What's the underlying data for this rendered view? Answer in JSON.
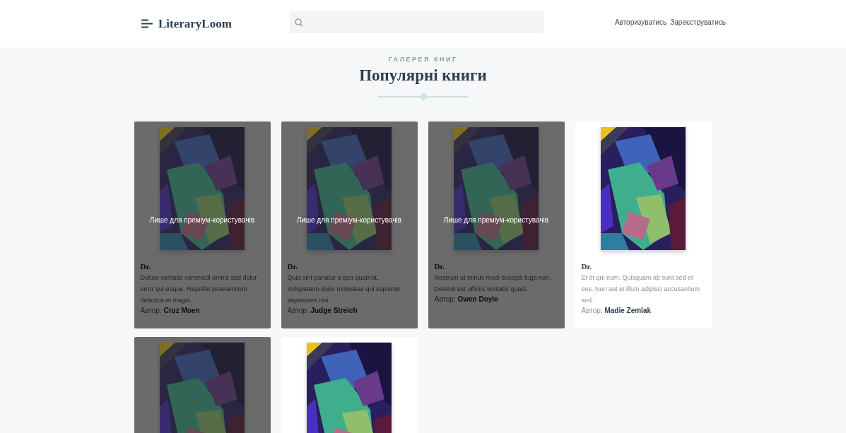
{
  "header": {
    "logo": "LiteraryLoom",
    "links": [
      "Авторизуватись",
      "Зареєструватись"
    ]
  },
  "section": {
    "eyebrow": "ГАЛЕРЕЯ КНИГ",
    "title": "Популярні книги"
  },
  "books": [
    {
      "locked": true,
      "overlay_text": "Лише для преміум-користувачів",
      "title": "Dr.",
      "description": "Dolore veritatis commodi omnis sed dolor error qui eaque. Repellat praesentium delectus et magni.",
      "author": "Автор: **Cruz Moen**"
    },
    {
      "locked": true,
      "overlay_text": "Лише для преміум-користувачів",
      "title": "Dr.",
      "description": "Quia sint pariatur a quo quaerat. Voluptatem dolor molestiae qui sapiente asperiores nisi.",
      "author": "Автор: **Judge Streich**"
    },
    {
      "locked": true,
      "overlay_text": "Лише для преміум-користувачів",
      "title": "Dr.",
      "description": "Nostrum ut minus modi suscipit fuga non. Deleniti est officiis veritatis quasi.",
      "author": "Автор: **Owen Doyle**"
    },
    {
      "locked": false,
      "title": "Dr.",
      "description": "Et et qui eum. Quisquam ab sunt sed et eos. Non aut et illum adipisci accusantium sed.",
      "author": "Автор: **Madie Zemlak**"
    },
    {
      "locked": true
    },
    {
      "locked": false
    }
  ]
}
